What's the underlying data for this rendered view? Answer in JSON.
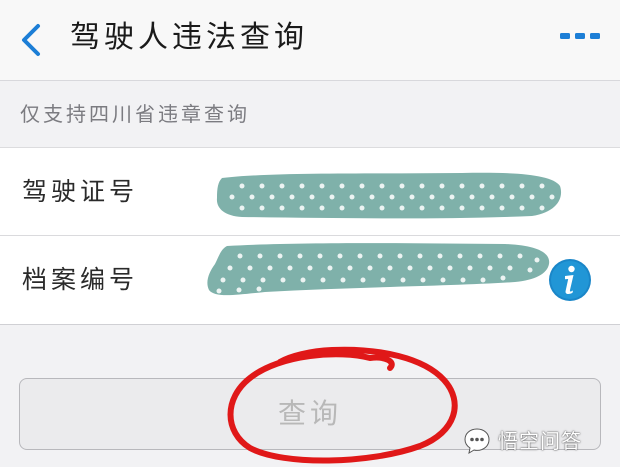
{
  "nav": {
    "back_icon": "chevron-left-icon",
    "title": "驾驶人违法查询",
    "more_icon": "more-dots-icon",
    "accent_color": "#1c7ed6"
  },
  "notice": {
    "text": "仅支持四川省违章查询"
  },
  "form": {
    "license": {
      "label": "驾驶证号",
      "value": ""
    },
    "archive": {
      "label": "档案编号",
      "value": "",
      "help_icon": "info-icon"
    }
  },
  "query_button": {
    "label": "查询"
  },
  "annotation": {
    "color": "#e01818"
  },
  "watermark": {
    "text": "悟空问答"
  }
}
